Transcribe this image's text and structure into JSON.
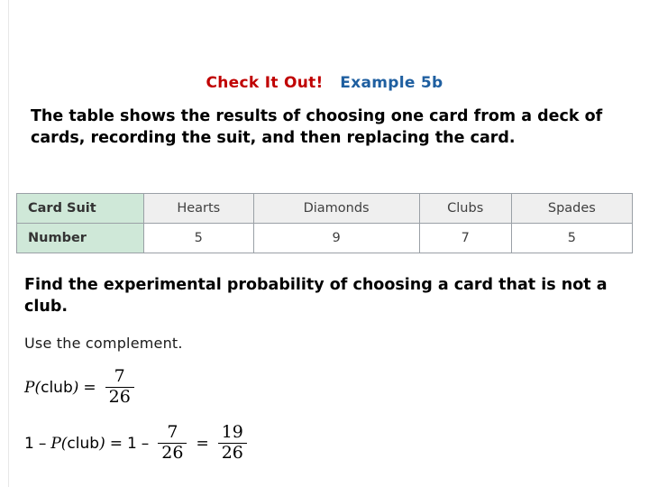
{
  "slide": {
    "heading": {
      "check_it_out": "Check It Out!",
      "example_label": "Example 5b",
      "check_color": "#c00000",
      "example_color": "#1f5fa0"
    },
    "intro_text": "The table shows the results of choosing one card from a deck of cards, recording the suit, and then replacing the card.",
    "table": {
      "row_headers": [
        "Card Suit",
        "Number"
      ],
      "columns": [
        "Hearts",
        "Diamonds",
        "Clubs",
        "Spades"
      ],
      "numbers": [
        "5",
        "9",
        "7",
        "5"
      ],
      "header_fill": "#cfe8d8",
      "cell_fill": "#efefef"
    },
    "question": "Find the experimental probability of choosing a card that is not a club.",
    "hint": "Use the complement.",
    "equation1": {
      "left_p": "P",
      "left_open": "(",
      "left_arg": "club",
      "left_close": ")",
      "equals": "=",
      "numerator": "7",
      "denominator": "26"
    },
    "equation2": {
      "one": "1",
      "minus": "–",
      "p": "P",
      "open": "(",
      "arg": "club",
      "close": ")",
      "equals1": "=",
      "one2": "1",
      "minus2": "–",
      "frac1_num": "7",
      "frac1_den": "26",
      "equals2": "=",
      "frac2_num": "19",
      "frac2_den": "26"
    }
  }
}
